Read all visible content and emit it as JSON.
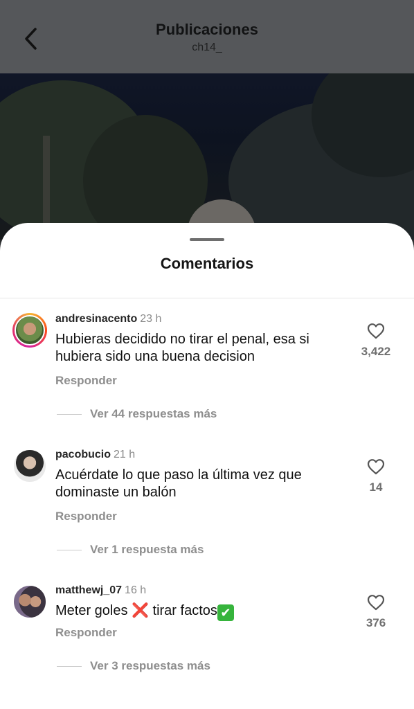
{
  "header": {
    "title": "Publicaciones",
    "subtitle": "ch14_",
    "back_icon": "chevron-left-icon"
  },
  "sheet": {
    "title": "Comentarios"
  },
  "comments": [
    {
      "username": "andresinacento",
      "time": "23 h",
      "text": "Hubieras decidido no tirar el penal, esa si hubiera sido una buena decision",
      "likes": "3,422",
      "reply_label": "Responder",
      "replies_label": "Ver 44 respuestas más",
      "has_story_ring": true
    },
    {
      "username": "pacobucio",
      "time": "21 h",
      "text": "Acuérdate lo que paso la última vez que dominaste un balón",
      "likes": "14",
      "reply_label": "Responder",
      "replies_label": "Ver 1 respuesta más",
      "has_story_ring": false
    },
    {
      "username": "matthewj_07",
      "time": "16 h",
      "text_before": "Meter goles ",
      "emoji_cross": "❌",
      "text_middle": " tirar factos",
      "emoji_check": "✔",
      "likes": "376",
      "reply_label": "Responder",
      "replies_label": "Ver 3 respuestas más",
      "has_story_ring": false
    }
  ],
  "colors": {
    "accent_ring": "#e1306c",
    "muted_text": "#8e8e8e"
  }
}
